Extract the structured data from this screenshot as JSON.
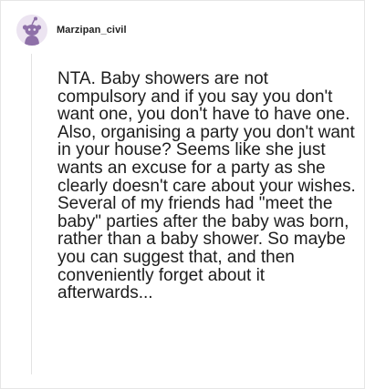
{
  "comment": {
    "username": "Marzipan_civil",
    "avatar_icon": "reddit-snoo-avatar",
    "body": "NTA. Baby showers are not compulsory and if you say you don't want one, you don't have to have one. Also, organising a party you don't want in your house? Seems like she just wants an excuse for a party as she clearly doesn't care about your wishes. Several of my friends had \"meet the baby\" parties after the baby was born, rather than a baby shower. So maybe you can suggest that, and then conveniently forget about it afterwards..."
  },
  "colors": {
    "avatar_bg": "#ece4f1",
    "avatar_figure": "#8e70a8",
    "text": "#1c1c1c",
    "thread_line": "#e3e3e3"
  }
}
